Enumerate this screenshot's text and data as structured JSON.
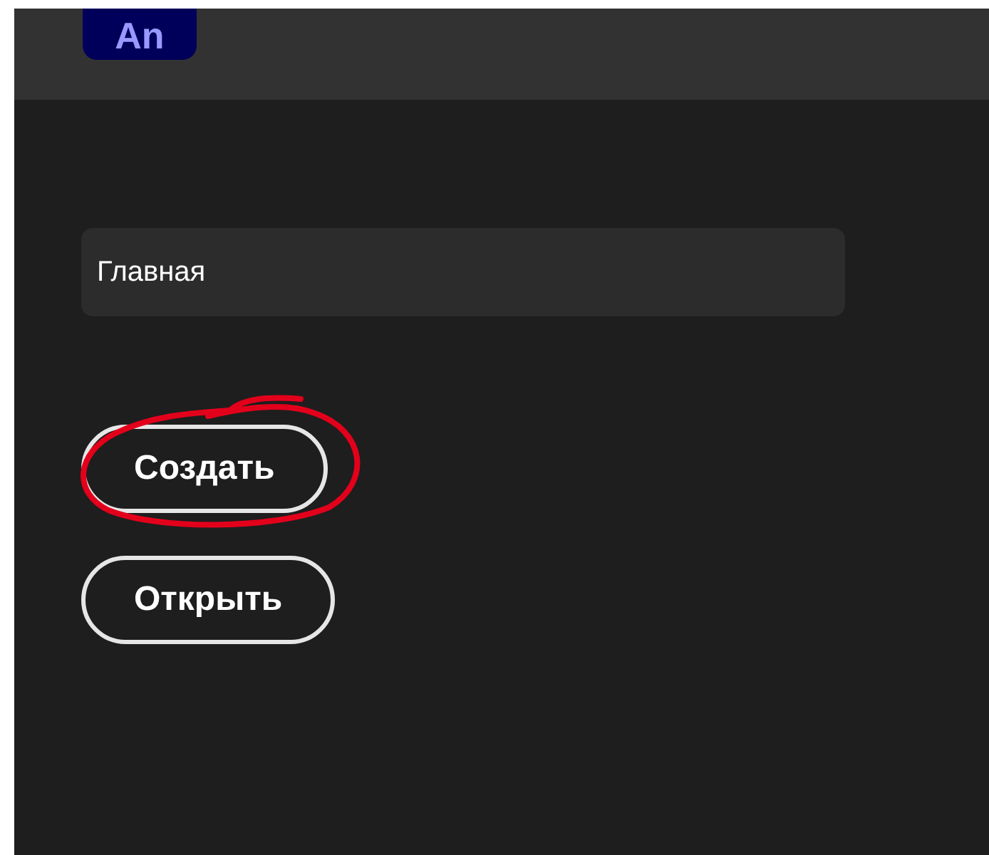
{
  "logo": {
    "text": "An"
  },
  "nav": [
    {
      "label": "Главная",
      "selected": true
    }
  ],
  "buttons": [
    {
      "label": "Создать",
      "highlighted": true
    },
    {
      "label": "Открыть",
      "highlighted": false
    }
  ]
}
